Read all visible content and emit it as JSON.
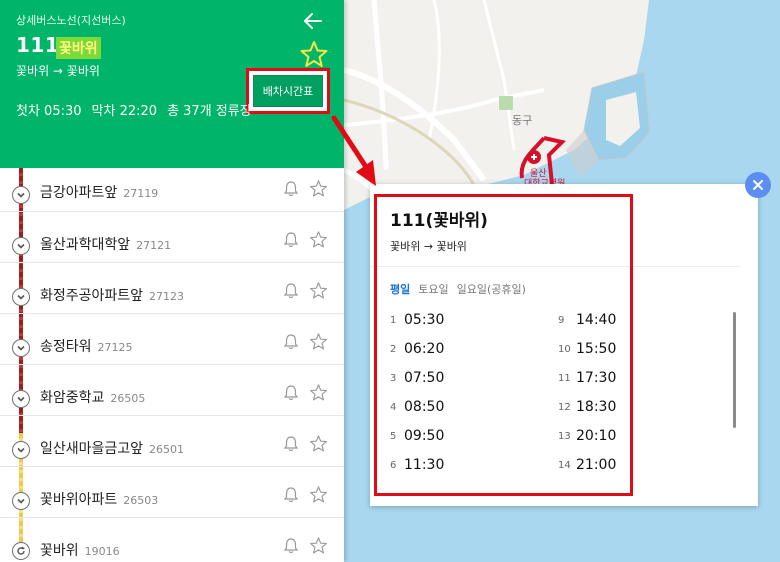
{
  "header": {
    "route_type": "상세버스노선(지선버스)",
    "route_number": "111",
    "route_name": "꽃바위",
    "route_path": "꽃바위 → 꽃바위",
    "timetable_button": "배차시간표",
    "first_bus": "첫차 05:30",
    "last_bus": "막차 22:20",
    "stop_count": "총 37개 정류장"
  },
  "stops": [
    {
      "name": "금강아파트앞",
      "number": "27119"
    },
    {
      "name": "울산과학대학앞",
      "number": "27121"
    },
    {
      "name": "화정주공아파트앞",
      "number": "27123"
    },
    {
      "name": "송정타워",
      "number": "27125"
    },
    {
      "name": "화암중학교",
      "number": "26505"
    },
    {
      "name": "일산새마을금고앞",
      "number": "26501"
    },
    {
      "name": "꽃바위아파트",
      "number": "26503"
    },
    {
      "name": "꽃바위",
      "number": "19016"
    }
  ],
  "map": {
    "district_label": "동구",
    "hospital_label_1": "울산",
    "hospital_label_2": "대학교병원"
  },
  "popup": {
    "title": "111(꽃바위)",
    "path": "꽃바위 → 꽃바위",
    "tabs": [
      "평일",
      "토요일",
      "일요일(공휴일)"
    ],
    "times_left": [
      {
        "idx": "1",
        "time": "05:30"
      },
      {
        "idx": "2",
        "time": "06:20"
      },
      {
        "idx": "3",
        "time": "07:50"
      },
      {
        "idx": "4",
        "time": "08:50"
      },
      {
        "idx": "5",
        "time": "09:50"
      },
      {
        "idx": "6",
        "time": "11:30"
      }
    ],
    "times_right": [
      {
        "idx": "9",
        "time": "14:40"
      },
      {
        "idx": "10",
        "time": "15:50"
      },
      {
        "idx": "11",
        "time": "17:30"
      },
      {
        "idx": "12",
        "time": "18:30"
      },
      {
        "idx": "13",
        "time": "20:10"
      },
      {
        "idx": "14",
        "time": "21:00"
      }
    ]
  },
  "colors": {
    "header_green": "#00b569",
    "highlight_red": "#e10b17",
    "route_line_red": "#9b1f1f",
    "route_line_yellow": "#f1c94a",
    "active_tab_blue": "#1b74d8",
    "close_button_blue": "#5b8ef0",
    "sea": "#a8d7ef"
  }
}
